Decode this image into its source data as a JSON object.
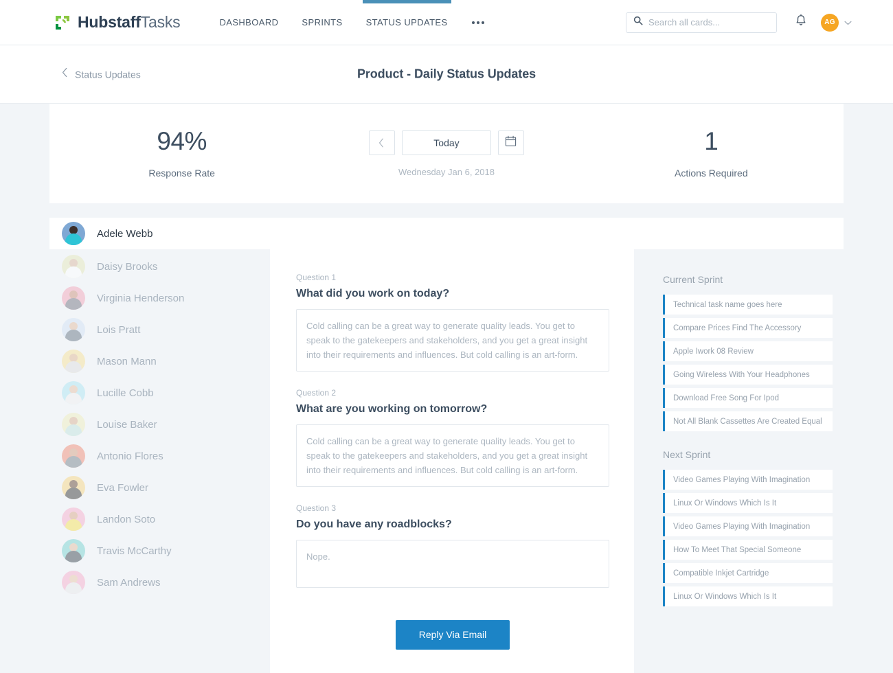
{
  "navbar": {
    "brand": {
      "bold": "Hubstaff",
      "light": "Tasks",
      "icon": "hubstaff-logo-icon"
    },
    "links": [
      {
        "label": "DASHBOARD",
        "active": false
      },
      {
        "label": "SPRINTS",
        "active": false
      },
      {
        "label": "STATUS UPDATES",
        "active": true
      }
    ],
    "more_label": "more-menu",
    "search": {
      "placeholder": "Search all cards...",
      "value": ""
    },
    "notifications_icon": "bell-icon",
    "user_initials": "AG",
    "accent_color": "#4a90b8",
    "avatar_color": "#f6a623"
  },
  "pagehead": {
    "breadcrumb": "Status Updates",
    "title": "Product - Daily Status Updates"
  },
  "stats": {
    "response_rate_value": "94%",
    "response_rate_label": "Response Rate",
    "prev_label": "‹",
    "today_label": "Today",
    "calendar_icon": "calendar-icon",
    "date_text": "Wednesday Jan 6, 2018",
    "actions_value": "1",
    "actions_label": "Actions Required"
  },
  "users": [
    {
      "name": "Adele Webb",
      "selected": true,
      "bg": "#7fa8d4",
      "skin": "#3b2e2a",
      "shirt": "#2ec4d6"
    },
    {
      "name": "Daisy Brooks",
      "selected": false,
      "bg": "#e4e6b7",
      "skin": "#d9b49a",
      "shirt": "#ffffff"
    },
    {
      "name": "Virginia Henderson",
      "selected": false,
      "bg": "#f4a0b5",
      "skin": "#c98a72",
      "shirt": "#6a6a78"
    },
    {
      "name": "Lois Pratt",
      "selected": false,
      "bg": "#cfe0f5",
      "skin": "#e2b89a",
      "shirt": "#5b6b7c"
    },
    {
      "name": "Mason Mann",
      "selected": false,
      "bg": "#f7df92",
      "skin": "#e0b48e",
      "shirt": "#dcdcdc"
    },
    {
      "name": "Lucille Cobb",
      "selected": false,
      "bg": "#a9e4f2",
      "skin": "#e6c0a2",
      "shirt": "#f0f0f0"
    },
    {
      "name": "Louise Baker",
      "selected": false,
      "bg": "#eeeeb8",
      "skin": "#d8ad8c",
      "shirt": "#bfe3dd"
    },
    {
      "name": "Antonio Flores",
      "selected": false,
      "bg": "#f0836b",
      "skin": "#d29a78",
      "shirt": "#6d7a85"
    },
    {
      "name": "Eva Fowler",
      "selected": false,
      "bg": "#f7d37a",
      "skin": "#5a3a26",
      "shirt": "#2a2a2a"
    },
    {
      "name": "Landon Soto",
      "selected": false,
      "bg": "#f7a8c8",
      "skin": "#d9a382",
      "shirt": "#f5e14a"
    },
    {
      "name": "Travis McCarthy",
      "selected": false,
      "bg": "#6fd0cc",
      "skin": "#e2bb9c",
      "shirt": "#2f3a44"
    },
    {
      "name": "Sam Andrews",
      "selected": false,
      "bg": "#f7a8c8",
      "skin": "#e8c3a4",
      "shirt": "#e8e8ea"
    }
  ],
  "questions": [
    {
      "label": "Question 1",
      "title": "What did you work on today?",
      "answer": "Cold calling can be a great way to generate quality leads. You get to speak to the gatekeepers and stakeholders, and you get a great insight into their requirements and influences. But cold calling is an art-form."
    },
    {
      "label": "Question 2",
      "title": "What are you working on tomorrow?",
      "answer": "Cold calling can be a great way to generate quality leads. You get to speak to the gatekeepers and stakeholders, and you get a great insight into their requirements and influences. But cold calling is an art-form."
    },
    {
      "label": "Question 3",
      "title": "Do you have any roadblocks?",
      "answer": "Nope."
    }
  ],
  "reply_button": "Reply Via Email",
  "sprint_panels": [
    {
      "title": "Current Sprint",
      "items": [
        "Technical task name goes here",
        "Compare Prices Find The Accessory",
        "Apple Iwork 08 Review",
        "Going Wireless With Your Headphones",
        "Download Free Song For Ipod",
        "Not All Blank Cassettes Are Created Equal"
      ]
    },
    {
      "title": "Next Sprint",
      "items": [
        "Video Games Playing With Imagination",
        "Linux Or Windows Which Is It",
        "Video Games Playing With Imagination",
        "How To Meet That Special Someone",
        "Compatible Inkjet Cartridge",
        "Linux Or Windows Which Is It"
      ]
    }
  ]
}
